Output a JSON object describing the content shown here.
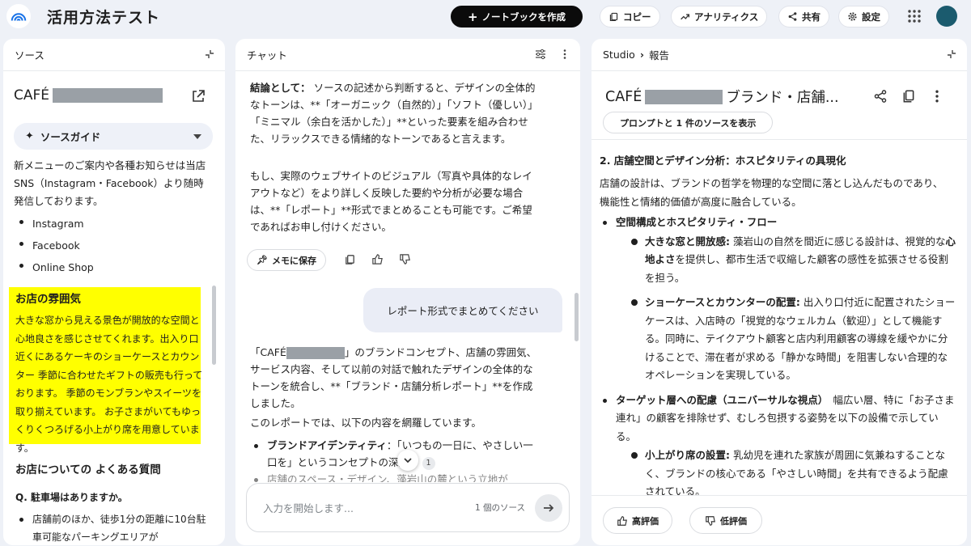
{
  "app": {
    "title": "活用方法テスト"
  },
  "toolbar": {
    "create_notebook": "ノートブックを作成",
    "copy": "コピー",
    "analytics": "アナリティクス",
    "share": "共有",
    "settings": "設定"
  },
  "sources": {
    "header": "ソース",
    "title_prefix": "CAFÉ",
    "guide_label": "ソースガイド",
    "intro": "新メニューのご案内や各種お知らせは当店SNS（Instagram・Facebook）より随時発信しております。",
    "links": [
      "Instagram",
      "Facebook",
      "Online Shop"
    ],
    "atmos_heading": "お店の雰囲気",
    "atmos_text": "大きな窓から見える景色が開放的な空間と心地良さを感じさせてくれます。出入り口近くにあるケーキのショーケースとカウンター 季節に合わせたギフトの販売も行っております。 季節のモンブランやスイーツを取り揃えています。 お子さまがいてもゆっくりくつろげる小上がり席を用意しています。",
    "faq_heading": "お店についての よくある質問",
    "faq_q1": "Q. 駐車場はありますか。",
    "faq_a1": "店舗前のほか、徒歩1分の距離に10台駐車可能なパーキングエリアが"
  },
  "chat": {
    "header": "チャット",
    "conclusion_label": "結論として：",
    "conclusion_text": "ソースの記述から判断すると、デザインの全体的なトーンは、**「オーガニック（自然的）」「ソフト（優しい）」「ミニマル（余白を活かした）」**といった要素を組み合わせた、リラックスできる情緒的なトーンであると言えます。",
    "followup_text": "もし、実際のウェブサイトのビジュアル（写真や具体的なレイアウトなど）をより詳しく反映した要約や分析が必要な場合は、**「レポート」**形式でまとめることも可能です。ご希望であればお申し付けください。",
    "save_memo": "メモに保存",
    "user_msg": "レポート形式でまとめてください",
    "reply_prefix": "「CAFÉ",
    "reply_text": "」のブランドコンセプト、店舗の雰囲気、サービス内容、そして以前の対話で触れたデザインの全体的なトーンを統合し、**「ブランド・店舗分析レポート」**を作成しました。",
    "reply_text2": "このレポートでは、以下の内容を網羅しています。",
    "bullet1_label": "ブランドアイデンティティ",
    "bullet1_text": "：「いつもの一日に、やさしい一口を」というコンセプトの深掘り",
    "bullet1_cite": "1",
    "bullet2_partial": "店舗のスペース・デザイン、藻岩山の麓という立地が",
    "input_placeholder": "入力を開始します...",
    "source_count": "1 個のソース"
  },
  "studio": {
    "crumb_root": "Studio",
    "crumb_current": "報告",
    "title_prefix": "CAFÉ",
    "title_suffix": "ブランド・店舗...",
    "prompt_btn": "プロンプトと 1 件のソースを表示",
    "section_heading": "2. 店舗空間とデザイン分析：ホスピタリティの具現化",
    "section_intro": "店舗の設計は、ブランドの哲学を物理的な空間に落とし込んだものであり、機能性と情緒的価値が高度に融合している。",
    "b1_title": "空間構成とホスピタリティ・フロー",
    "b1_s1_label": "大きな窓と開放感:",
    "b1_s1_text_a": "藻岩山の自然を間近に感じる設計は、視覚的な",
    "b1_s1_bold": "心地よさ",
    "b1_s1_text_b": "を提供し、都市生活で収縮した顧客の感性を拡張させる役割を担う。",
    "b1_s2_label": "ショーケースとカウンターの配置:",
    "b1_s2_text": "出入り口付近に配置されたショーケースは、入店時の「視覚的なウェルカム（歓迎）」として機能する。同時に、テイクアウト顧客と店内利用顧客の導線を緩やかに分けることで、滞在者が求める「静かな時間」を阻害しない合理的なオペレーションを実現している。",
    "b2_title": "ターゲット層への配慮（ユニバーサルな視点）",
    "b2_text": "幅広い層、特に「お子さま連れ」の顧客を排除せず、むしろ包摂する姿勢を以下の設備で示している。",
    "b2_s1_label": "小上がり席の設置:",
    "b2_s1_text": "乳幼児を連れた家族が周囲に気兼ねすることなく、ブランドの核心である「やさしい時間」を共有できるよう配慮されている。",
    "like": "高評価",
    "dislike": "低評価"
  }
}
